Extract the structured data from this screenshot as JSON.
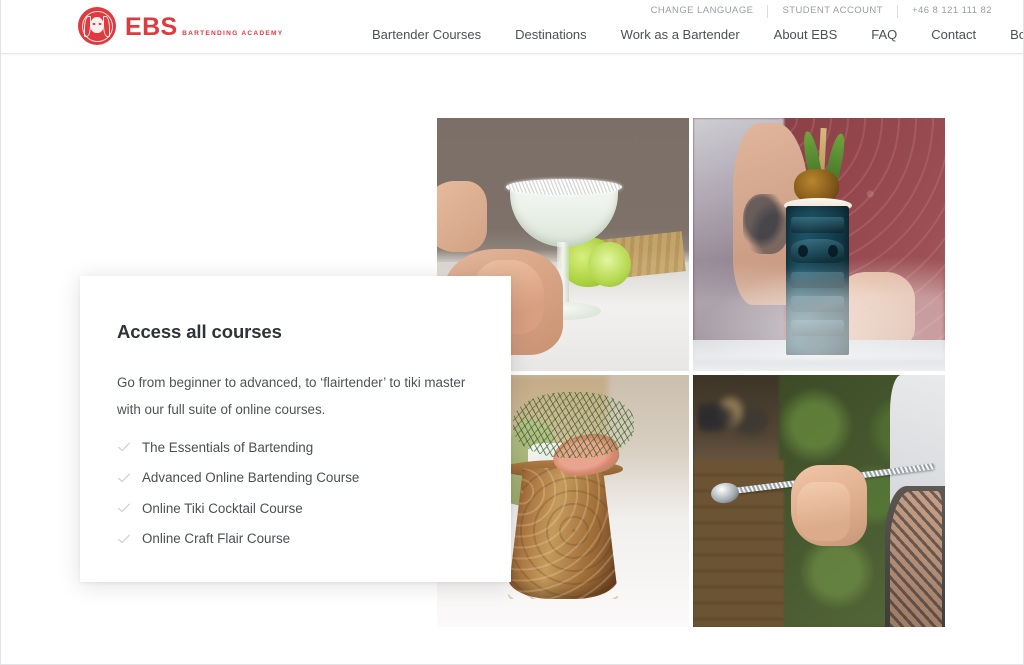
{
  "header": {
    "utility": [
      {
        "label": "CHANGE LANGUAGE"
      },
      {
        "label": "STUDENT ACCOUNT"
      },
      {
        "label": "+46 8 121 111 82"
      }
    ],
    "brand": {
      "name": "EBS",
      "tagline": "BARTENDING ACADEMY",
      "color": "#e0393e"
    },
    "nav": [
      {
        "label": "Bartender Courses"
      },
      {
        "label": "Destinations"
      },
      {
        "label": "Work as a Bartender"
      },
      {
        "label": "About EBS"
      },
      {
        "label": "FAQ"
      },
      {
        "label": "Contact"
      },
      {
        "label": "Book now"
      }
    ]
  },
  "card": {
    "title": "Access all courses",
    "description": "Go from beginner to advanced, to ‘flairtender’ to tiki master with our full suite of online courses.",
    "courses": [
      {
        "label": "The Essentials of Bartending"
      },
      {
        "label": "Advanced Online Bartending Course"
      },
      {
        "label": "Online Tiki Cocktail Course"
      },
      {
        "label": "Online Craft Flair Course"
      }
    ]
  },
  "gallery": [
    {
      "alt": "Margarita cocktail in salt-rimmed coupe glass with lime wedges"
    },
    {
      "alt": "Dark teal tiki mug cocktail with charred fruit and leaf garnish"
    },
    {
      "alt": "Hammered copper mug cocktail with fig slice and dill garnish"
    },
    {
      "alt": "Tattooed bartender hand holding a twisted bar spoon"
    }
  ]
}
